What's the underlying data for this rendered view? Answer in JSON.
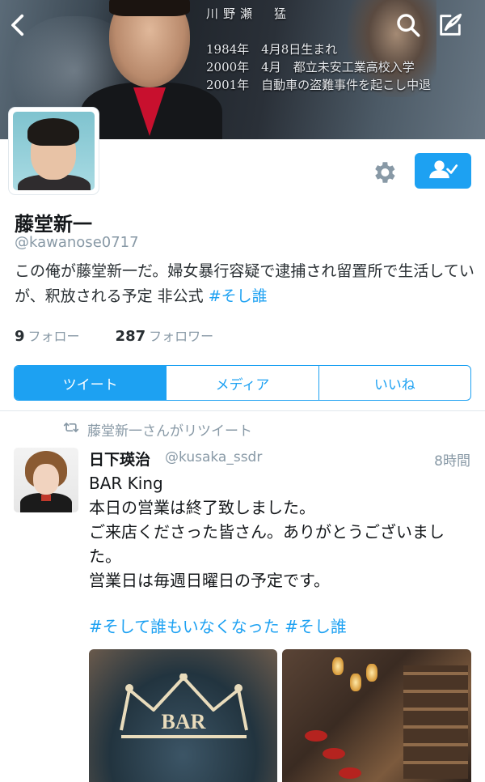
{
  "banner": {
    "name": "川野瀬　猛",
    "lines": [
      "1984年　4月8日生まれ",
      "2000年　4月　都立未安工業高校入学",
      "2001年　自動車の盗難事件を起こし中退"
    ]
  },
  "profile": {
    "display_name": "藤堂新一",
    "handle": "@kawanose0717",
    "bio_text": "この俺が藤堂新一だ。婦女暴行容疑で逮捕され留置所で生活していが、釈放される予定 非公式 ",
    "bio_hashtag": "#そし誰",
    "following_count": "9",
    "following_label": "フォロー",
    "followers_count": "287",
    "followers_label": "フォロワー"
  },
  "tabs": [
    {
      "label": "ツイート",
      "active": true
    },
    {
      "label": "メディア",
      "active": false
    },
    {
      "label": "いいね",
      "active": false
    }
  ],
  "tweet": {
    "retweet_label": "藤堂新一さんがリツイート",
    "author_name": "日下瑛治",
    "author_handle": "@kusaka_ssdr",
    "time": "8時間",
    "lines": [
      "BAR King",
      "本日の営業は終了致しました。",
      "ご来店くださった皆さん。ありがとうございました。",
      "営業日は毎週日曜日の予定です。"
    ],
    "hashtags": "#そして誰もいなくなった #そし誰",
    "media_crown_text": "BAR"
  },
  "colors": {
    "accent": "#1da1f2",
    "muted": "#8899a6",
    "text": "#14171a"
  },
  "icons": [
    "back-icon",
    "search-icon",
    "compose-icon",
    "gear-icon",
    "follow-user-icon",
    "retweet-icon"
  ]
}
